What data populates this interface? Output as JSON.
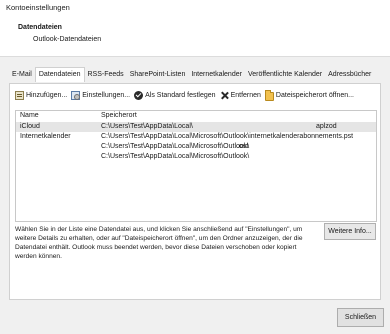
{
  "window": {
    "title": "Kontoeinstellungen"
  },
  "header": {
    "title": "Datendateien",
    "subtitle": "Outlook-Datendateien"
  },
  "tabs": [
    {
      "label": "E-Mail"
    },
    {
      "label": "Datendateien",
      "active": true
    },
    {
      "label": "RSS-Feeds"
    },
    {
      "label": "SharePoint-Listen"
    },
    {
      "label": "Internetkalender"
    },
    {
      "label": "Veröffentlichte Kalender"
    },
    {
      "label": "Adressbücher"
    }
  ],
  "toolbar": {
    "add": "Hinzufügen...",
    "settings": "Einstellungen...",
    "default": "Als Standard festlegen",
    "remove": "Entfernen",
    "open_location": "Dateispeicherort öffnen..."
  },
  "list": {
    "headers": {
      "name": "Name",
      "location": "Speicherort"
    },
    "rows": [
      {
        "name": "iCloud",
        "location": "C:\\Users\\Test\\AppData\\Local\\",
        "extra": "aplzod",
        "selected": true
      },
      {
        "name": "Internetkalender",
        "location": "C:\\Users\\Test\\AppData\\Local\\Microsoft\\Outlook\\internetkalenderabonnements.pst",
        "extra": ""
      },
      {
        "name": "",
        "location": "C:\\Users\\Test\\AppData\\Local\\Microsoft\\Outlook\\",
        "extra": ".ost"
      },
      {
        "name": "",
        "location": "C:\\Users\\Test\\AppData\\Local\\Microsoft\\Outlook\\",
        "extra": ""
      }
    ]
  },
  "description": "Wählen Sie in der Liste eine Datendatei aus, und klicken Sie anschließend auf \"Einstellungen\", um weitere Details zu erhalten, oder auf \"Dateispeicherort öffnen\", um den Ordner anzuzeigen, der die Datendatei enthält. Outlook muss beendet werden, bevor diese Dateien verschoben oder kopiert werden können.",
  "buttons": {
    "more_info": "Weitere Info...",
    "close": "Schließen"
  }
}
